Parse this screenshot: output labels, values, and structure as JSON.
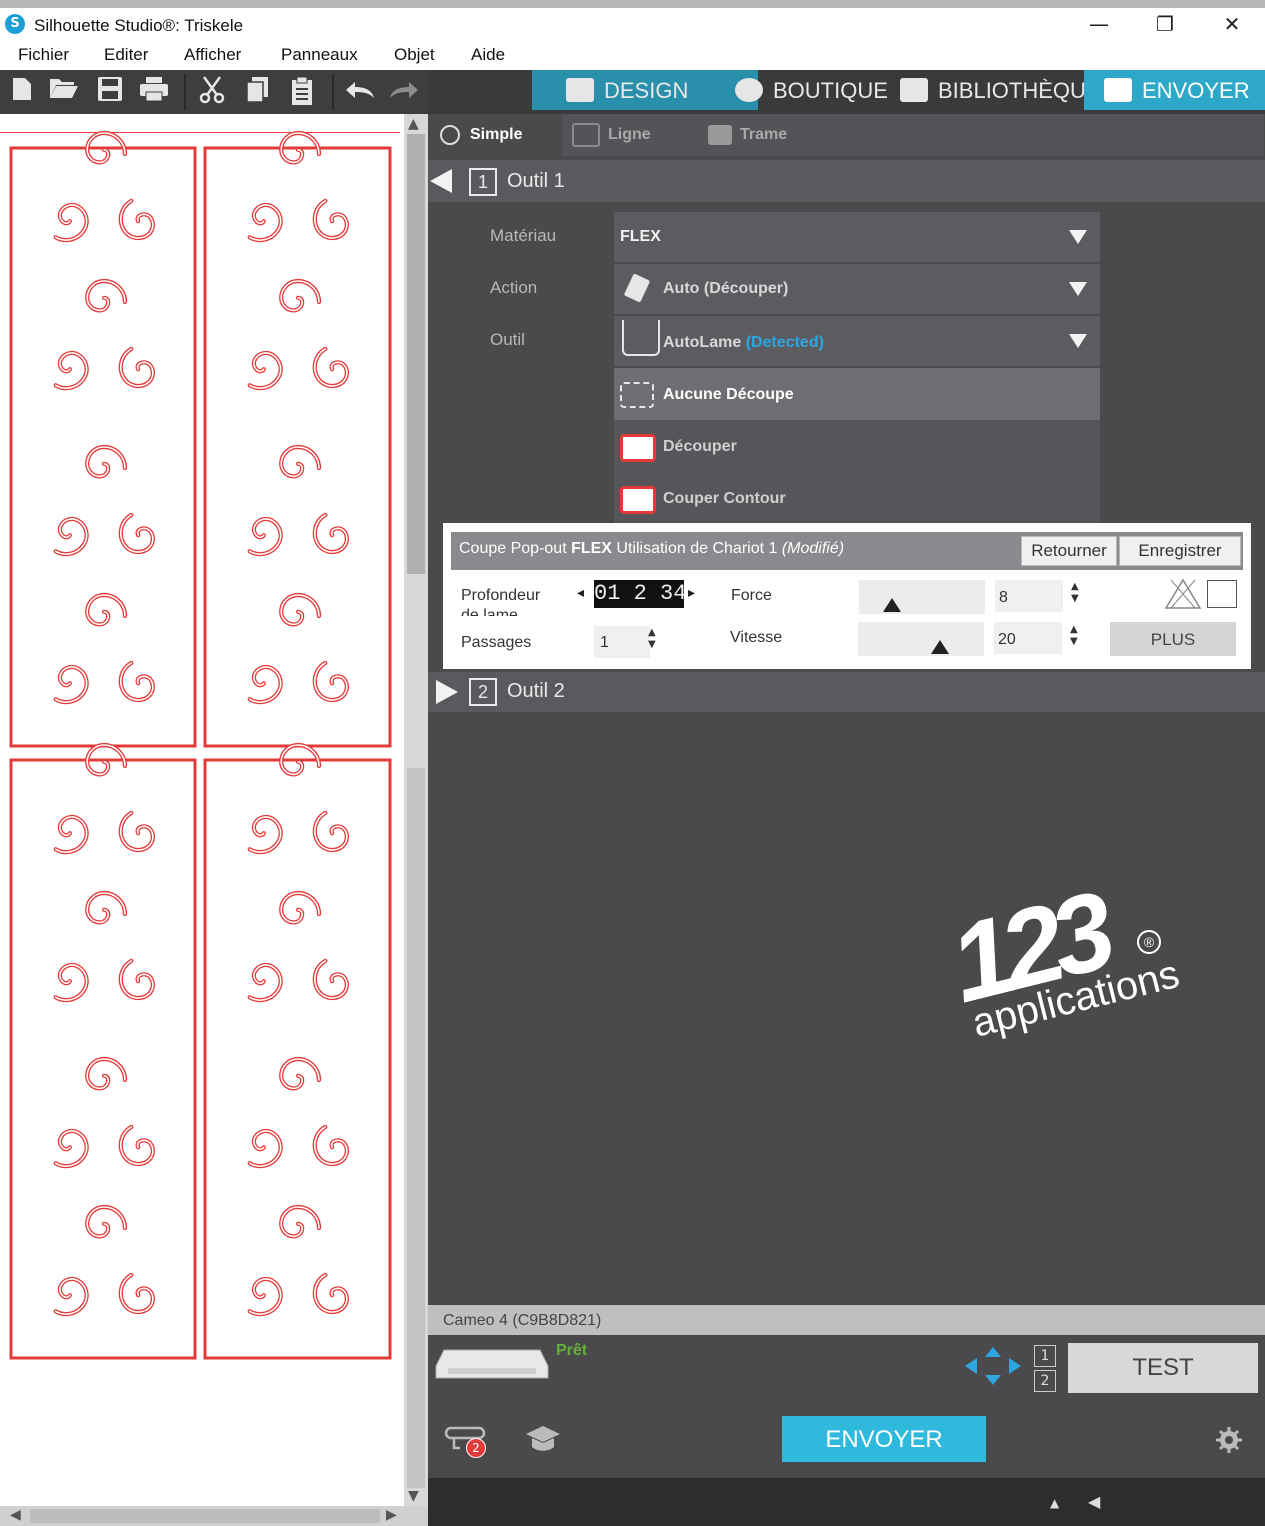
{
  "window": {
    "title": "Silhouette Studio®: Triskele",
    "logo_letter": "S",
    "minimize": "—",
    "restore": "❐",
    "close": "✕"
  },
  "menu": [
    "Fichier",
    "Editer",
    "Afficher",
    "Panneaux",
    "Objet",
    "Aide"
  ],
  "toolbar_icons": [
    "new-file-icon",
    "open-folder-icon",
    "save-icon",
    "print-icon",
    "cut-icon",
    "copy-icon",
    "paste-icon",
    "undo-icon",
    "redo-icon"
  ],
  "nav_tabs": [
    {
      "label": "DESIGN",
      "icon": "grid-icon"
    },
    {
      "label": "BOUTIQUE",
      "icon": "store-icon"
    },
    {
      "label": "BIBLIOTHÈQUE",
      "icon": "library-icon"
    },
    {
      "label": "ENVOYER",
      "icon": "send-icon",
      "active": true
    }
  ],
  "mode_tabs": [
    {
      "label": "Simple",
      "active": true
    },
    {
      "label": "Ligne"
    },
    {
      "label": "Trame"
    }
  ],
  "tool1": {
    "number": "1",
    "title": "Outil 1",
    "material_label": "Matériau",
    "material_value": "FLEX",
    "action_label": "Action",
    "action_value": "Auto (Découper)",
    "tool_label": "Outil",
    "tool_value": "AutoLame",
    "tool_detected": "(Detected)",
    "cut_options": [
      {
        "label": "Aucune Découpe",
        "selected": true
      },
      {
        "label": "Découper"
      },
      {
        "label": "Couper Contour"
      }
    ]
  },
  "settings": {
    "header_prefix": "Coupe Pop-out ",
    "header_material": "FLEX",
    "header_middle": " Utilisation de Chariot 1 ",
    "header_modified": "(Modifié)",
    "btn_return": "Retourner",
    "btn_save": "Enregistrer",
    "blade_depth_label": "Profondeur de lame",
    "blade_depth_digits": "01 2 34",
    "passes_label": "Passages",
    "passes_value": "1",
    "force_label": "Force",
    "force_value": "8",
    "speed_label": "Vitesse",
    "speed_value": "20",
    "more_button": "PLUS"
  },
  "tool2": {
    "number": "2",
    "title": "Outil 2"
  },
  "device": {
    "name": "Cameo 4 (C9B8D821)",
    "status": "Prêt",
    "test_button": "TEST",
    "send_button": "ENVOYER",
    "tool_slot_1": "1",
    "tool_slot_2": "2",
    "badge_count": "2"
  },
  "watermark": {
    "number": "123",
    "text": "applications",
    "registered": "®"
  },
  "colors": {
    "accent": "#2fb9dc",
    "detected": "#2ea6e0",
    "ready": "#5fb33a",
    "design_stroke": "#e53a3a"
  }
}
